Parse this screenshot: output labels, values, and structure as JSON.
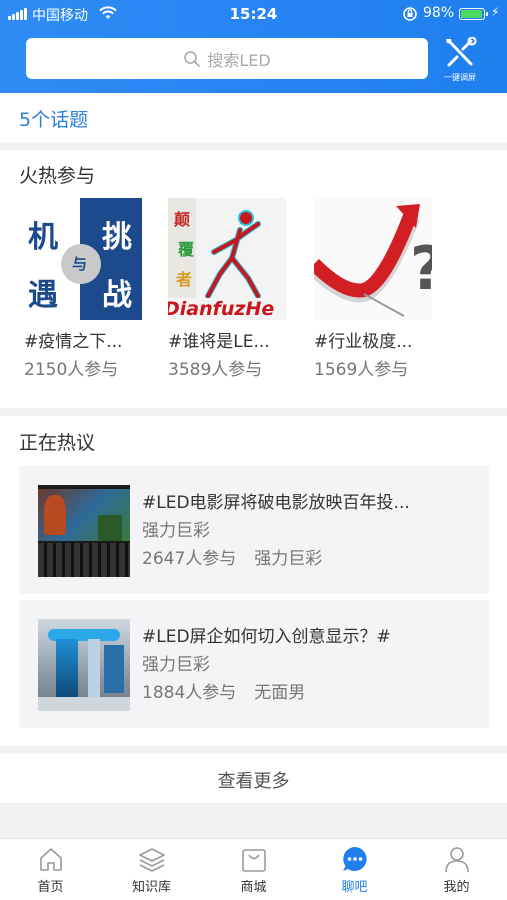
{
  "status_bar": {
    "carrier": "中国移动",
    "time": "15:24",
    "battery": "98%"
  },
  "search": {
    "placeholder": "搜索LED"
  },
  "tool": {
    "label": "一键调屏"
  },
  "topic_count": "5个话题",
  "hot": {
    "title": "火热参与",
    "items": [
      {
        "title": "#疫情之下...",
        "count": "2150人参与",
        "thumb_text": [
          "机",
          "挑",
          "与",
          "遇",
          "战"
        ]
      },
      {
        "title": "#谁将是LE...",
        "count": "3589人参与",
        "thumb_text": [
          "颠",
          "覆",
          "者",
          "DianfuzHe"
        ]
      },
      {
        "title": "#行业极度...",
        "count": "1569人参与",
        "thumb_text": [
          "?"
        ]
      }
    ]
  },
  "discussions": {
    "title": "正在热议",
    "items": [
      {
        "title": "#LED电影屏将破电影放映百年投...",
        "author": "强力巨彩",
        "count": "2647人参与",
        "user": "强力巨彩"
      },
      {
        "title": "#LED屏企如何切入创意显示？#",
        "author": "强力巨彩",
        "count": "1884人参与",
        "user": "无面男"
      }
    ]
  },
  "more_label": "查看更多",
  "tabs": [
    {
      "label": "首页",
      "icon": "home-icon"
    },
    {
      "label": "知识库",
      "icon": "layers-icon"
    },
    {
      "label": "商城",
      "icon": "shopping-bag-icon"
    },
    {
      "label": "聊吧",
      "icon": "chat-icon",
      "active": true
    },
    {
      "label": "我的",
      "icon": "user-icon"
    }
  ],
  "colors": {
    "brand": "#1f7fee",
    "battery": "#4cd964"
  }
}
